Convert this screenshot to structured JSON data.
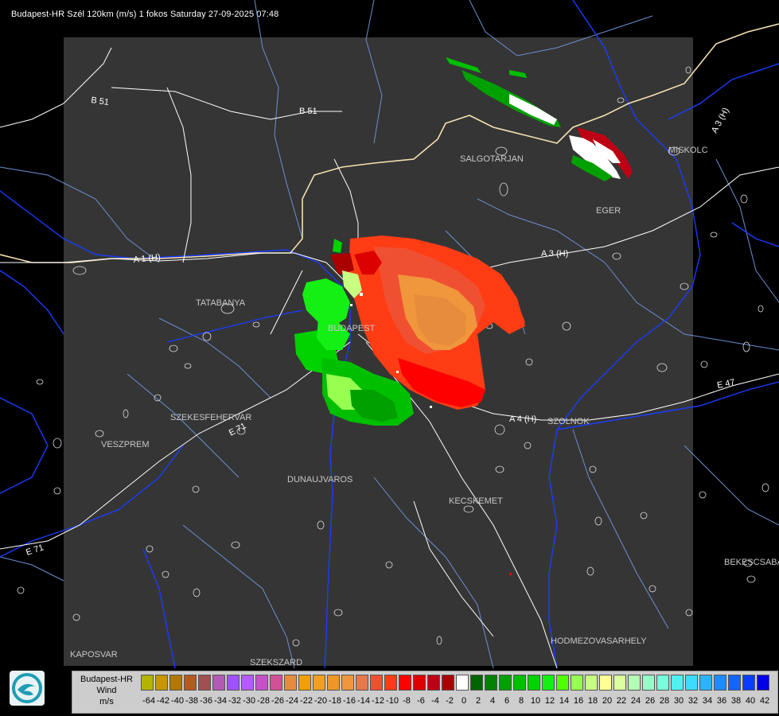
{
  "title": "Budapest-HR Szél 120km (m/s) 1 fokos Saturday 27-09-2025 07:48",
  "map": {
    "cities": [
      {
        "name": "SALGOTARJAN"
      },
      {
        "name": "MISKOLC"
      },
      {
        "name": "EGER"
      },
      {
        "name": "TATABANYA"
      },
      {
        "name": "BUDAPEST"
      },
      {
        "name": "SZEKESFEHERVAR"
      },
      {
        "name": "VESZPREM"
      },
      {
        "name": "DUNAUJVAROS"
      },
      {
        "name": "KECSKEMET"
      },
      {
        "name": "SZOLNOK"
      },
      {
        "name": "BEKESCSABA"
      },
      {
        "name": "HODMEZOVASARHELY"
      },
      {
        "name": "KAPOSVAR"
      },
      {
        "name": "SZEKSZARD"
      }
    ],
    "roads": [
      {
        "label": "B 51"
      },
      {
        "label": "B 51"
      },
      {
        "label": "A 3 (H)"
      },
      {
        "label": "A 3 (H)"
      },
      {
        "label": "A 4 (H)"
      },
      {
        "label": "A 1 (H)"
      },
      {
        "label": "E 71"
      },
      {
        "label": "E 71"
      },
      {
        "label": "E 47"
      }
    ],
    "colors": {
      "background": "#000000",
      "coverage": "#353535",
      "border": "#f5e0b0",
      "rivers": "#1a3cff",
      "roads": "#ffffff",
      "county_lines": "#6a8fd0"
    }
  },
  "legend": {
    "title_lines": [
      "Budapest-HR",
      "Wind",
      "m/s"
    ],
    "logo_icon": "hungarian-met-service-logo-icon",
    "bins": [
      {
        "label": "-64",
        "color": "#b4b400"
      },
      {
        "label": "-42",
        "color": "#c89600"
      },
      {
        "label": "-40",
        "color": "#b47800"
      },
      {
        "label": "-38",
        "color": "#b45a1e"
      },
      {
        "label": "-36",
        "color": "#a05050"
      },
      {
        "label": "-34",
        "color": "#b45ab4"
      },
      {
        "label": "-32",
        "color": "#a050ff"
      },
      {
        "label": "-30",
        "color": "#b45aff"
      },
      {
        "label": "-28",
        "color": "#c850c8"
      },
      {
        "label": "-26",
        "color": "#d25096"
      },
      {
        "label": "-24",
        "color": "#e68c3c"
      },
      {
        "label": "-22",
        "color": "#f0a000"
      },
      {
        "label": "-20",
        "color": "#f0a01e"
      },
      {
        "label": "-18",
        "color": "#f09628"
      },
      {
        "label": "-16",
        "color": "#f0963c"
      },
      {
        "label": "-14",
        "color": "#e6784b"
      },
      {
        "label": "-12",
        "color": "#f05032"
      },
      {
        "label": "-10",
        "color": "#ff3c14"
      },
      {
        "label": "-8",
        "color": "#ff0000"
      },
      {
        "label": "-6",
        "color": "#dc0000"
      },
      {
        "label": "-4",
        "color": "#be0014"
      },
      {
        "label": "-2",
        "color": "#aa0000"
      },
      {
        "label": "0",
        "color": "#ffffff"
      },
      {
        "label": "2",
        "color": "#006400"
      },
      {
        "label": "4",
        "color": "#008200"
      },
      {
        "label": "6",
        "color": "#00a000"
      },
      {
        "label": "8",
        "color": "#00be00"
      },
      {
        "label": "10",
        "color": "#00d200"
      },
      {
        "label": "12",
        "color": "#14f014"
      },
      {
        "label": "14",
        "color": "#50ff00"
      },
      {
        "label": "16",
        "color": "#96ff50"
      },
      {
        "label": "18",
        "color": "#c8ff82"
      },
      {
        "label": "20",
        "color": "#ffff96"
      },
      {
        "label": "22",
        "color": "#dcffa0"
      },
      {
        "label": "24",
        "color": "#b4ffb4"
      },
      {
        "label": "26",
        "color": "#96ffc8"
      },
      {
        "label": "28",
        "color": "#78ffdc"
      },
      {
        "label": "30",
        "color": "#50f0f0"
      },
      {
        "label": "32",
        "color": "#3cdcff"
      },
      {
        "label": "34",
        "color": "#28b4ff"
      },
      {
        "label": "36",
        "color": "#1e8cff"
      },
      {
        "label": "38",
        "color": "#1464ff"
      },
      {
        "label": "40",
        "color": "#0a3cff"
      },
      {
        "label": "42",
        "color": "#0000e6"
      }
    ]
  }
}
